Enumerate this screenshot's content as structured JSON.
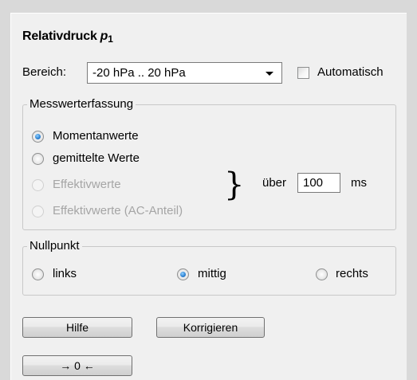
{
  "title": {
    "text": "Relativdruck",
    "symbol": "p",
    "subscript": "1"
  },
  "range": {
    "label": "Bereich:",
    "value": "-20 hPa .. 20 hPa",
    "auto_label": "Automatisch",
    "auto_checked": false
  },
  "acquisition": {
    "legend": "Messwerterfassung",
    "options": [
      {
        "label": "Momentanwerte",
        "checked": true,
        "enabled": true
      },
      {
        "label": "gemittelte Werte",
        "checked": false,
        "enabled": true
      },
      {
        "label": "Effektivwerte",
        "checked": false,
        "enabled": false
      },
      {
        "label": "Effektivwerte (AC-Anteil)",
        "checked": false,
        "enabled": false
      }
    ],
    "brace": "}",
    "over_label": "über",
    "duration_value": "100",
    "duration_unit": "ms"
  },
  "zero_point": {
    "legend": "Nullpunkt",
    "options": [
      {
        "label": "links",
        "checked": false
      },
      {
        "label": "mittig",
        "checked": true
      },
      {
        "label": "rechts",
        "checked": false
      }
    ]
  },
  "buttons": {
    "help": "Hilfe",
    "correct": "Korrigieren",
    "zero": "→ 0 ←"
  },
  "colors": {
    "panel": "#f0f0f0",
    "background": "#d9d9d9",
    "radio_accent": "#2a7fd0"
  }
}
